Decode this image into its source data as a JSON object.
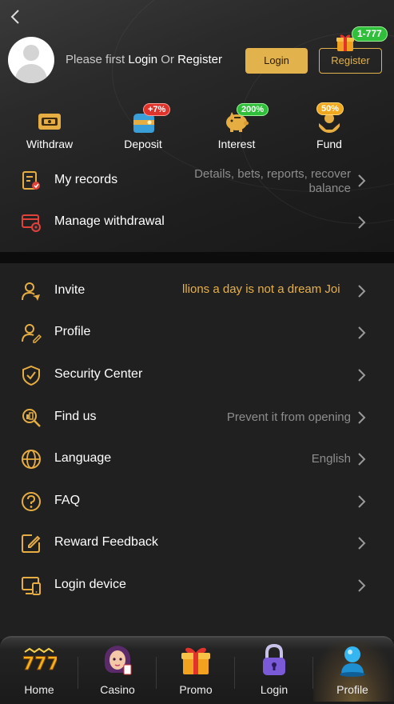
{
  "header": {
    "back_icon": "chevron-left-icon",
    "prompt_prefix": "Please first",
    "prompt_login": "Login",
    "prompt_or": "Or",
    "prompt_register": "Register",
    "login_button": "Login",
    "register_button": "Register",
    "gift_badge": "1-777"
  },
  "quick_actions": [
    {
      "label": "Withdraw",
      "icon": "wallet-card-icon",
      "badge": ""
    },
    {
      "label": "Deposit",
      "icon": "purse-icon",
      "badge": "+7%",
      "badge_color": "#e0332c"
    },
    {
      "label": "Interest",
      "icon": "piggy-bank-icon",
      "badge": "200%",
      "badge_color": "#2fbf3a"
    },
    {
      "label": "Fund",
      "icon": "hand-coin-icon",
      "badge": "50%",
      "badge_color": "#f0a81e"
    }
  ],
  "menu_top": [
    {
      "label": "My records",
      "value_line1": "Details, bets, reports, recover",
      "value_line2": "balance",
      "icon": "records-icon"
    },
    {
      "label": "Manage withdrawal",
      "value_line1": "",
      "icon": "withdrawal-settings-icon"
    }
  ],
  "menu_bottom": [
    {
      "label": "Invite",
      "value": "llions a day is not a dream  Joi",
      "icon": "invite-user-icon"
    },
    {
      "label": "Profile",
      "value": "",
      "icon": "profile-edit-icon"
    },
    {
      "label": "Security Center",
      "value": "",
      "icon": "shield-check-icon"
    },
    {
      "label": "Find us",
      "value": "Prevent it from opening",
      "icon": "find-search-icon"
    },
    {
      "label": "Language",
      "value": "English",
      "icon": "globe-icon"
    },
    {
      "label": "FAQ",
      "value": "",
      "icon": "question-icon"
    },
    {
      "label": "Reward Feedback",
      "value": "",
      "icon": "edit-note-icon"
    },
    {
      "label": "Login device",
      "value": "",
      "icon": "devices-icon"
    }
  ],
  "tabbar": [
    {
      "label": "Home",
      "icon": "slot-777-icon"
    },
    {
      "label": "Casino",
      "icon": "casino-girl-icon"
    },
    {
      "label": "Promo",
      "icon": "gift-box-icon"
    },
    {
      "label": "Login",
      "icon": "padlock-icon"
    },
    {
      "label": "Profile",
      "icon": "user-bust-icon",
      "active": true
    }
  ],
  "colors": {
    "accent_gold": "#e2b24c",
    "icon_gold": "#e6ad42",
    "icon_red": "#e0423a",
    "muted_text": "#8d8d8d"
  }
}
